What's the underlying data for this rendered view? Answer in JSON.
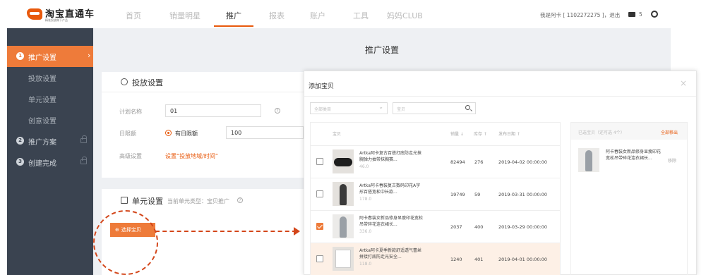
{
  "brand": {
    "title": "淘宝直通车",
    "subtitle": "精准投放做下产品"
  },
  "nav": {
    "items": [
      "首页",
      "销量明星",
      "推广",
      "报表",
      "账户",
      "工具",
      "妈妈CLUB"
    ],
    "active": "推广"
  },
  "user": {
    "info": "我是阿卡 [ 1102272275 ]，退出",
    "mail_count": "5"
  },
  "sidebar": {
    "items": [
      {
        "num": "1",
        "label": "推广设置",
        "active": true
      },
      {
        "label": "投放设置"
      },
      {
        "label": "单元设置"
      },
      {
        "label": "创意设置"
      },
      {
        "num": "2",
        "label": "推广方案"
      },
      {
        "num": "3",
        "label": "创建完成"
      }
    ]
  },
  "page": {
    "title": "推广设置"
  },
  "delivery": {
    "section_title": "投放设置",
    "plan_name_label": "计划名称",
    "plan_name_value": "01",
    "daily_limit_label": "日限额",
    "daily_limit_option": "有日限额",
    "daily_limit_value": "100",
    "advanced_label": "高级设置",
    "advanced_link": "设置“投放地域/时间”"
  },
  "unit": {
    "section_title": "单元设置",
    "current_type": "当前单元类型：宝贝推广",
    "select_button": "选择宝贝"
  },
  "modal": {
    "title": "添加宝贝",
    "close": "×",
    "category_placeholder": "全部类目",
    "search_placeholder": "宝贝",
    "columns": {
      "item": "宝贝",
      "sales": "销量 ↓",
      "stock": "库存 ↑",
      "publish_date": "发布日期 ↑"
    },
    "rows": [
      {
        "name": "Artka阿卡复古百搭打底防走光抹胸弹力抽带抹胸赛...",
        "price": "46.0",
        "sales": "82494",
        "stock": "276",
        "date": "2019-04-02 00:00:00",
        "checked": false
      },
      {
        "name": "Artka阿卡春装复古数码印花A字形百搭宽松中长款...",
        "price": "178.0",
        "sales": "19749",
        "stock": "59",
        "date": "2019-03-31 00:00:00",
        "checked": false
      },
      {
        "name": "阿卡春装女新品修身显瘦印花宽松吊带碎花连衣裙长...",
        "price": "336.0",
        "sales": "2037",
        "stock": "400",
        "date": "2019-03-29 00:00:00",
        "checked": true
      },
      {
        "name": "Artka阿卡夏季新款舒适透气蕾丝拼接打底防走光安全...",
        "price": "118.0",
        "sales": "1240",
        "stock": "401",
        "date": "2019-04-01 00:00:00",
        "checked": false
      }
    ],
    "selected_panel": {
      "title": "已选宝贝（还可选 4个）",
      "remove_all": "全部移出",
      "items": [
        {
          "name": "阿卡春装女新品修身显瘦印花宽松吊带碎花连衣裙长...",
          "remove": "移除"
        }
      ]
    }
  },
  "colors": {
    "accent": "#e8590c",
    "sidebar_bg": "#3a4350",
    "sidebar_active": "#ee7b3a",
    "annotation": "#d3461a"
  }
}
